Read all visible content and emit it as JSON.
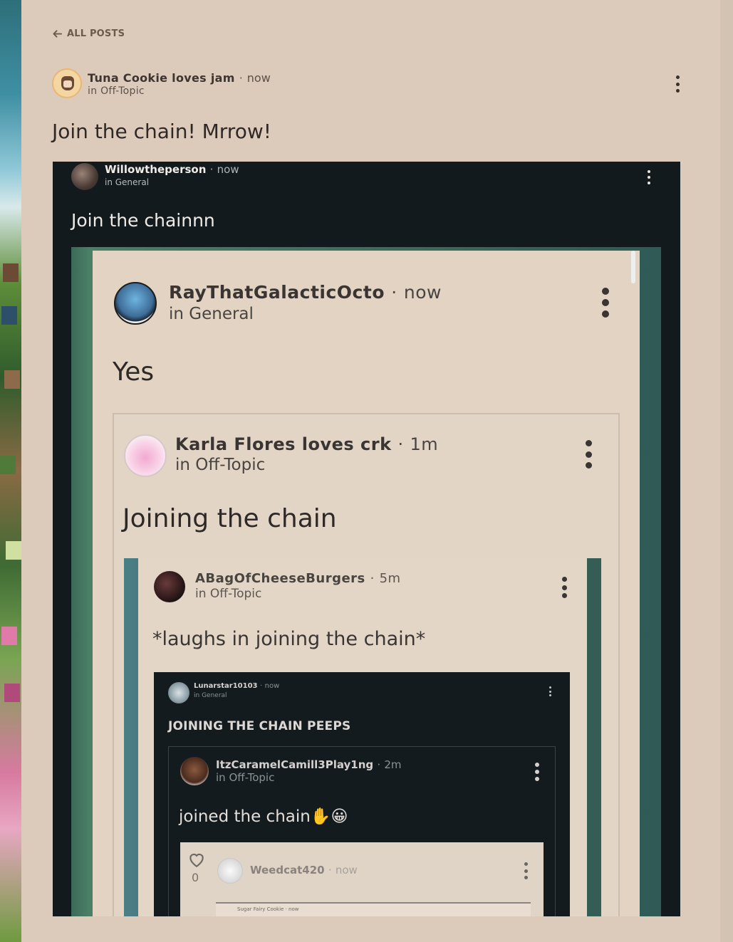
{
  "nav": {
    "back_label": "ALL POSTS"
  },
  "post": {
    "author": "Tuna Cookie loves jam",
    "time": "now",
    "community": "in Off-Topic",
    "body": "Join the chain! Mrrow!"
  },
  "embedded": {
    "author": "Willowtheperson",
    "time": "now",
    "community": "in General",
    "body": "Join the chainnn",
    "nested": {
      "author": "RayThatGalacticOcto",
      "time": "now",
      "community": "in General",
      "body": "Yes",
      "nested": {
        "author": "Karla Flores loves crk",
        "time": "1m",
        "community": "in Off-Topic",
        "body": "Joining the chain",
        "nested": {
          "author": "ABagOfCheeseBurgers",
          "time": "5m",
          "community": "in Off-Topic",
          "body": "*laughs in joining the chain*",
          "nested": {
            "author": "Lunarstar10103",
            "time": "now",
            "community": "in General",
            "body": "JOINING THE CHAIN PEEPS",
            "nested": {
              "author": "ItzCaramelCamill3Play1ng",
              "time": "2m",
              "community": "in Off-Topic",
              "body": "joined the chain✋😀",
              "nested": {
                "like_count": "0",
                "author": "Weedcat420",
                "time": "now",
                "nested_author": "Sugar Fairy Cookie · now"
              }
            }
          }
        }
      }
    }
  },
  "icons": {
    "back": "arrow-left-icon",
    "more": "kebab-menu-icon",
    "like": "heart-icon"
  }
}
